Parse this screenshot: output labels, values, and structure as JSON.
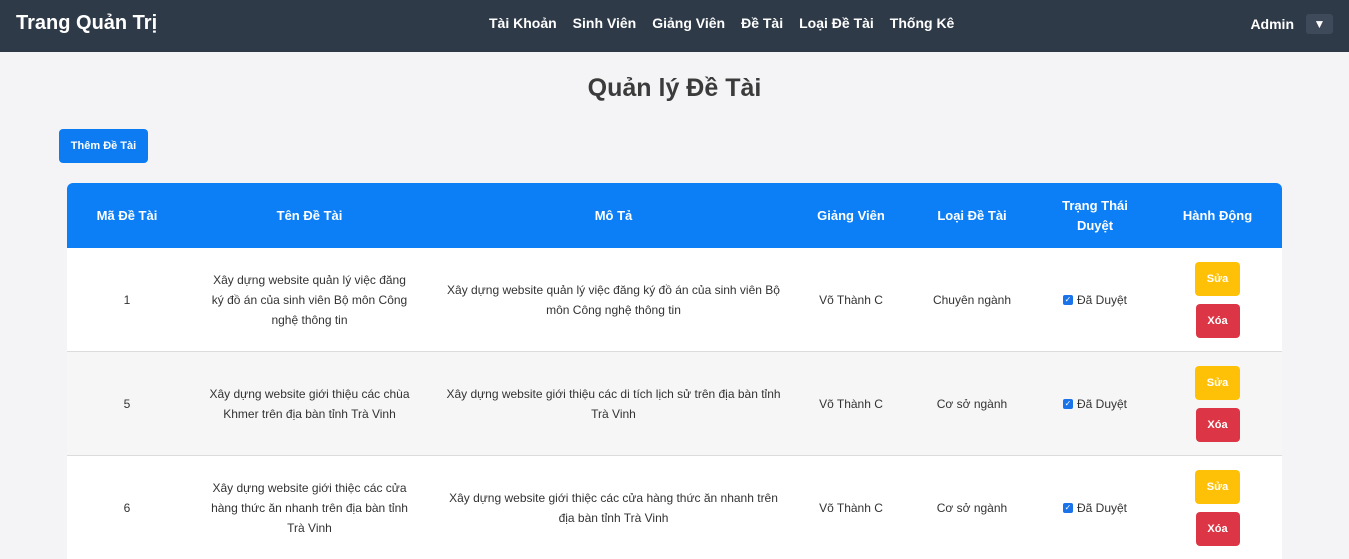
{
  "header": {
    "brand": "Trang Quản Trị",
    "menu": [
      "Tài Khoản",
      "Sinh Viên",
      "Giảng Viên",
      "Đề Tài",
      "Loại Đề Tài",
      "Thống Kê"
    ],
    "user": "Admin",
    "dropdown_icon": "▼"
  },
  "page": {
    "title": "Quản lý Đề Tài",
    "add_button": "Thêm Đề Tài"
  },
  "table": {
    "headers": [
      "Mã Đề Tài",
      "Tên Đề Tài",
      "Mô Tả",
      "Giảng Viên",
      "Loại Đề Tài",
      "Trạng Thái Duyệt",
      "Hành Động"
    ],
    "rows": [
      {
        "id": "1",
        "name": "Xây dựng website quản lý việc đăng ký đồ án của sinh viên Bộ môn Công nghệ thông tin",
        "desc": "Xây dựng website quản lý việc đăng ký đồ án của sinh viên Bộ môn Công nghệ thông tin",
        "lecturer": "Võ Thành C",
        "type": "Chuyên ngành",
        "status": "Đã Duyệt",
        "edit": "Sửa",
        "delete": "Xóa"
      },
      {
        "id": "5",
        "name": "Xây dựng website giới thiệu các chùa Khmer trên địa bàn tỉnh Trà Vinh",
        "desc": "Xây dựng website giới thiệu các di tích lịch sử trên địa bàn tỉnh Trà Vinh",
        "lecturer": "Võ Thành C",
        "type": "Cơ sở ngành",
        "status": "Đã Duyệt",
        "edit": "Sửa",
        "delete": "Xóa"
      },
      {
        "id": "6",
        "name": "Xây dựng website giới thiệc các cửa hàng thức ăn nhanh trên địa bàn tỉnh Trà Vinh",
        "desc": "Xây dựng website giới thiệc các cửa hàng thức ăn nhanh trên địa bàn tỉnh Trà Vinh",
        "lecturer": "Võ Thành C",
        "type": "Cơ sở ngành",
        "status": "Đã Duyệt",
        "edit": "Sửa",
        "delete": "Xóa"
      }
    ]
  },
  "colors": {
    "navbar": "#2f3a48",
    "primary": "#0c7ff7",
    "warning": "#ffc107",
    "danger": "#dc3545"
  }
}
